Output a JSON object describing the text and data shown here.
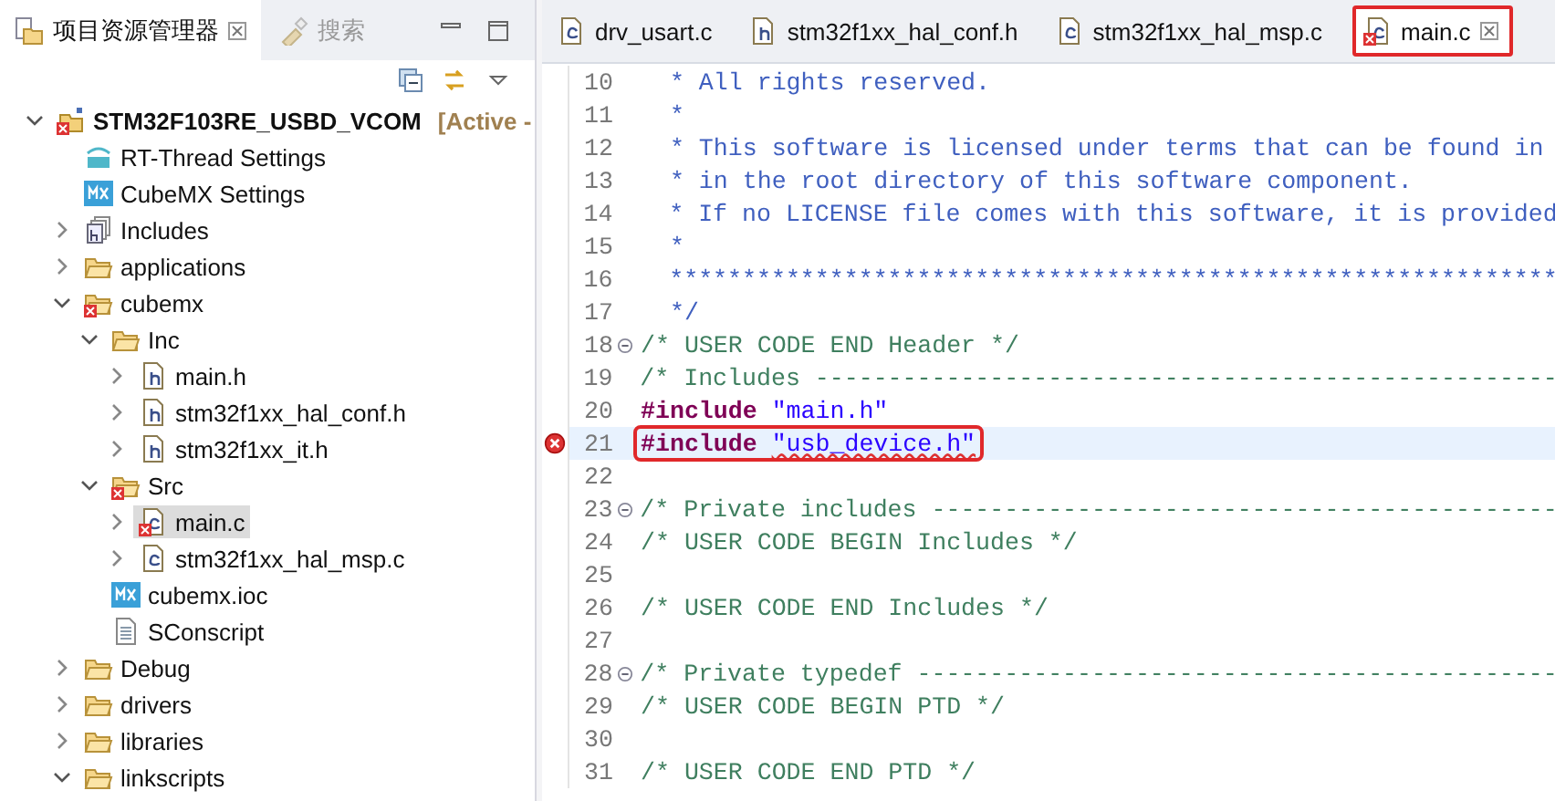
{
  "explorer": {
    "tabs": [
      {
        "label": "项目资源管理器",
        "selected": true
      },
      {
        "label": "搜索",
        "selected": false
      }
    ],
    "tree": [
      {
        "label": "STM32F103RE_USBD_VCOM",
        "suffix": "[Active -",
        "kind": "project",
        "error": true,
        "expanded": true,
        "selected": false,
        "children": [
          {
            "label": "RT-Thread Settings",
            "kind": "rt",
            "error": false,
            "selected": false
          },
          {
            "label": "CubeMX Settings",
            "kind": "mx",
            "error": false,
            "selected": false
          },
          {
            "label": "Includes",
            "kind": "includes",
            "error": false,
            "expanded": false,
            "selected": false
          },
          {
            "label": "applications",
            "kind": "folder",
            "error": false,
            "expanded": false,
            "selected": false
          },
          {
            "label": "cubemx",
            "kind": "folder",
            "error": true,
            "expanded": true,
            "selected": false,
            "children": [
              {
                "label": "Inc",
                "kind": "folder",
                "error": false,
                "expanded": true,
                "selected": false,
                "children": [
                  {
                    "label": "main.h",
                    "kind": "h",
                    "error": false,
                    "expanded": false,
                    "selected": false
                  },
                  {
                    "label": "stm32f1xx_hal_conf.h",
                    "kind": "h",
                    "error": false,
                    "expanded": false,
                    "selected": false
                  },
                  {
                    "label": "stm32f1xx_it.h",
                    "kind": "h",
                    "error": false,
                    "expanded": false,
                    "selected": false
                  }
                ]
              },
              {
                "label": "Src",
                "kind": "folder",
                "error": true,
                "expanded": true,
                "selected": false,
                "children": [
                  {
                    "label": "main.c",
                    "kind": "c",
                    "error": true,
                    "expanded": false,
                    "selected": true
                  },
                  {
                    "label": "stm32f1xx_hal_msp.c",
                    "kind": "c",
                    "error": false,
                    "expanded": false,
                    "selected": false
                  }
                ]
              },
              {
                "label": "cubemx.ioc",
                "kind": "mx",
                "error": false,
                "selected": false
              },
              {
                "label": "SConscript",
                "kind": "file",
                "error": false,
                "selected": false
              }
            ]
          },
          {
            "label": "Debug",
            "kind": "folder",
            "error": false,
            "expanded": false,
            "selected": false
          },
          {
            "label": "drivers",
            "kind": "folder",
            "error": false,
            "expanded": false,
            "selected": false
          },
          {
            "label": "libraries",
            "kind": "folder",
            "error": false,
            "expanded": false,
            "selected": false
          },
          {
            "label": "linkscripts",
            "kind": "folder",
            "error": false,
            "expanded": true,
            "selected": false
          }
        ]
      }
    ]
  },
  "editor": {
    "tabs": [
      {
        "label": "drv_usart.c",
        "kind": "c",
        "error": false,
        "selected": false,
        "highlighted": false
      },
      {
        "label": "stm32f1xx_hal_conf.h",
        "kind": "h",
        "error": false,
        "selected": false,
        "highlighted": false
      },
      {
        "label": "stm32f1xx_hal_msp.c",
        "kind": "c",
        "error": false,
        "selected": false,
        "highlighted": false
      },
      {
        "label": "main.c",
        "kind": "c",
        "error": true,
        "selected": true,
        "highlighted": true
      }
    ],
    "lines": [
      {
        "number": "10",
        "fold": false,
        "error": false,
        "current": false,
        "highlighted": false,
        "segments": [
          {
            "kind": "doc",
            "text": "  * All rights reserved."
          }
        ]
      },
      {
        "number": "11",
        "fold": false,
        "error": false,
        "current": false,
        "highlighted": false,
        "segments": [
          {
            "kind": "doc",
            "text": "  *"
          }
        ]
      },
      {
        "number": "12",
        "fold": false,
        "error": false,
        "current": false,
        "highlighted": false,
        "segments": [
          {
            "kind": "doc",
            "text": "  * This software is licensed under terms that can be found in"
          }
        ]
      },
      {
        "number": "13",
        "fold": false,
        "error": false,
        "current": false,
        "highlighted": false,
        "segments": [
          {
            "kind": "doc",
            "text": "  * in the root directory of this software component."
          }
        ]
      },
      {
        "number": "14",
        "fold": false,
        "error": false,
        "current": false,
        "highlighted": false,
        "segments": [
          {
            "kind": "doc",
            "text": "  * If no LICENSE file comes with this software, it is provided"
          }
        ]
      },
      {
        "number": "15",
        "fold": false,
        "error": false,
        "current": false,
        "highlighted": false,
        "segments": [
          {
            "kind": "doc",
            "text": "  *"
          }
        ]
      },
      {
        "number": "16",
        "fold": false,
        "error": false,
        "current": false,
        "highlighted": false,
        "segments": [
          {
            "kind": "doc",
            "text": "  *************************************************************"
          }
        ]
      },
      {
        "number": "17",
        "fold": false,
        "error": false,
        "current": false,
        "highlighted": false,
        "segments": [
          {
            "kind": "doc",
            "text": "  */"
          }
        ]
      },
      {
        "number": "18",
        "fold": true,
        "error": false,
        "current": false,
        "highlighted": false,
        "segments": [
          {
            "kind": "comment",
            "text": "/* USER CODE END Header */"
          }
        ]
      },
      {
        "number": "19",
        "fold": false,
        "error": false,
        "current": false,
        "highlighted": false,
        "segments": [
          {
            "kind": "comment",
            "text": "/* Includes ---------------------------------------------------"
          }
        ]
      },
      {
        "number": "20",
        "fold": false,
        "error": false,
        "current": false,
        "highlighted": false,
        "segments": [
          {
            "kind": "keyword",
            "text": "#include"
          },
          {
            "kind": "string",
            "text": "\"main.h\""
          }
        ]
      },
      {
        "number": "21",
        "fold": false,
        "error": true,
        "current": true,
        "highlighted": true,
        "segments": [
          {
            "kind": "keyword",
            "text": "#include"
          },
          {
            "kind": "string",
            "text": "\"usb_device.h\""
          }
        ]
      },
      {
        "number": "22",
        "fold": false,
        "error": false,
        "current": false,
        "highlighted": false
      },
      {
        "number": "23",
        "fold": true,
        "error": false,
        "current": false,
        "highlighted": false,
        "segments": [
          {
            "kind": "comment",
            "text": "/* Private includes -------------------------------------------"
          }
        ]
      },
      {
        "number": "24",
        "fold": false,
        "error": false,
        "current": false,
        "highlighted": false,
        "segments": [
          {
            "kind": "comment",
            "text": "/* USER CODE BEGIN Includes */"
          }
        ]
      },
      {
        "number": "25",
        "fold": false,
        "error": false,
        "current": false,
        "highlighted": false
      },
      {
        "number": "26",
        "fold": false,
        "error": false,
        "current": false,
        "highlighted": false,
        "segments": [
          {
            "kind": "comment",
            "text": "/* USER CODE END Includes */"
          }
        ]
      },
      {
        "number": "27",
        "fold": false,
        "error": false,
        "current": false,
        "highlighted": false
      },
      {
        "number": "28",
        "fold": true,
        "error": false,
        "current": false,
        "highlighted": false,
        "segments": [
          {
            "kind": "comment",
            "text": "/* Private typedef --------------------------------------------"
          }
        ]
      },
      {
        "number": "29",
        "fold": false,
        "error": false,
        "current": false,
        "highlighted": false,
        "segments": [
          {
            "kind": "comment",
            "text": "/* USER CODE BEGIN PTD */"
          }
        ]
      },
      {
        "number": "30",
        "fold": false,
        "error": false,
        "current": false,
        "highlighted": false
      },
      {
        "number": "31",
        "fold": false,
        "error": false,
        "current": false,
        "highlighted": false,
        "segments": [
          {
            "kind": "comment",
            "text": "/* USER CODE END PTD */"
          }
        ]
      }
    ]
  }
}
